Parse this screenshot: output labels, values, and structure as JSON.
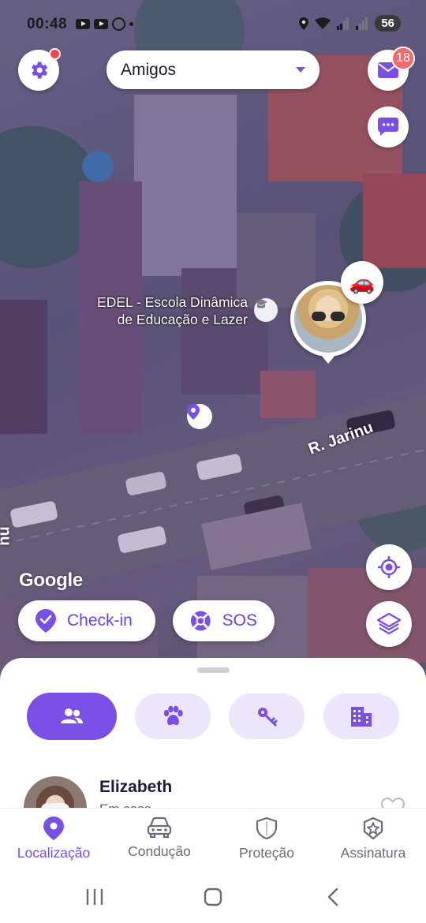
{
  "status_bar": {
    "time": "00:48",
    "battery": "56",
    "icons": [
      "youtube-icon",
      "youtube-icon",
      "whatsapp-icon",
      "dot-icon",
      "location-icon",
      "wifi-icon",
      "signal-icon",
      "signal-icon"
    ]
  },
  "header": {
    "group_selector": "Amigos",
    "mail_badge": "18"
  },
  "map": {
    "poi_name_line1": "EDEL - Escola Dinâmica",
    "poi_name_line2": "de Educação e Lazer",
    "street_name": "R. Jarinu",
    "street_name_partial": "nu",
    "provider_logo": "Google"
  },
  "actions": {
    "checkin_label": "Check-in",
    "sos_label": "SOS"
  },
  "tabs": [
    {
      "id": "friends",
      "icon": "people-icon",
      "active": true
    },
    {
      "id": "pets",
      "icon": "paw-icon",
      "active": false
    },
    {
      "id": "keys",
      "icon": "keys-icon",
      "active": false
    },
    {
      "id": "buildings",
      "icon": "buildings-icon",
      "active": false
    }
  ],
  "members": [
    {
      "name": "Elizabeth",
      "subtitle": "Em casa"
    }
  ],
  "bottom_nav": {
    "items": [
      {
        "label": "Localização",
        "icon": "location-pin-icon",
        "active": true
      },
      {
        "label": "Condução",
        "icon": "car-icon",
        "active": false
      },
      {
        "label": "Proteção",
        "icon": "shield-icon",
        "active": false
      },
      {
        "label": "Assinatura",
        "icon": "star-badge-icon",
        "active": false
      }
    ]
  },
  "colors": {
    "accent": "#7a4fe6",
    "accent_light": "#ece5fb",
    "badge": "#f16b6b"
  }
}
